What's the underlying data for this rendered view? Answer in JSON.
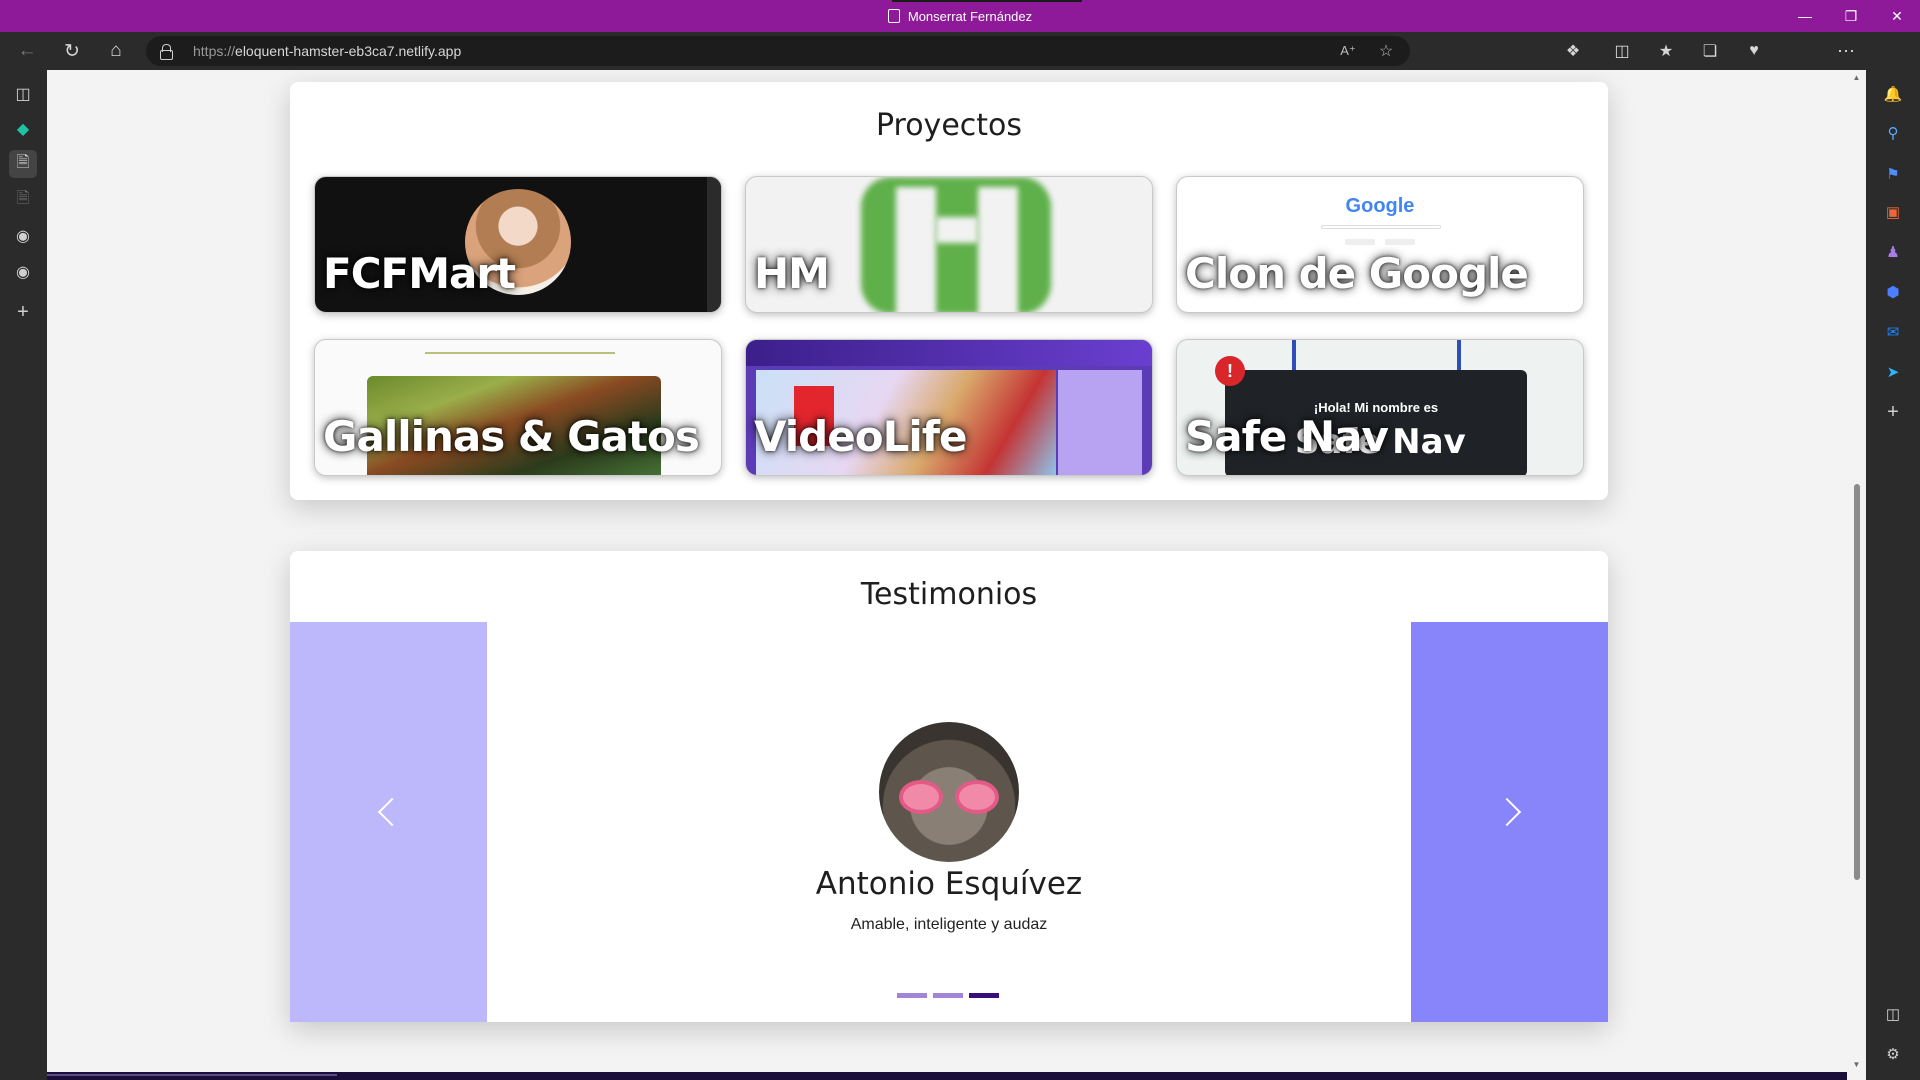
{
  "window": {
    "title": "Monserrat Fernández",
    "controls": [
      "minimize",
      "restore",
      "close"
    ]
  },
  "toolbar": {
    "url_protocol": "https://",
    "url_host": "eloquent-hamster-eb3ca7.netlify.app"
  },
  "projects": {
    "heading": "Proyectos",
    "items": [
      {
        "label": "FCFMart"
      },
      {
        "label": "HM"
      },
      {
        "label": "Clon de Google"
      },
      {
        "label": "Gallinas & Gatos"
      },
      {
        "label": "VideoLife"
      },
      {
        "label": "Safe Nav"
      }
    ],
    "google_logo": "Google",
    "safenav_greeting": "¡Hola! Mi nombre es",
    "safenav_inner_title": "Safe Nav"
  },
  "testimonials": {
    "heading": "Testimonios",
    "name": "Antonio Esquívez",
    "quote": "Amable, inteligente y audaz",
    "indicator_count": 3,
    "active_indicator": 3
  },
  "colors": {
    "titlebar": "#8e1a9a",
    "carousel_left": "#bdb8fb",
    "carousel_right": "#8884fa",
    "indicator_inactive": "#a385d6",
    "indicator_active": "#3a0e7a"
  }
}
